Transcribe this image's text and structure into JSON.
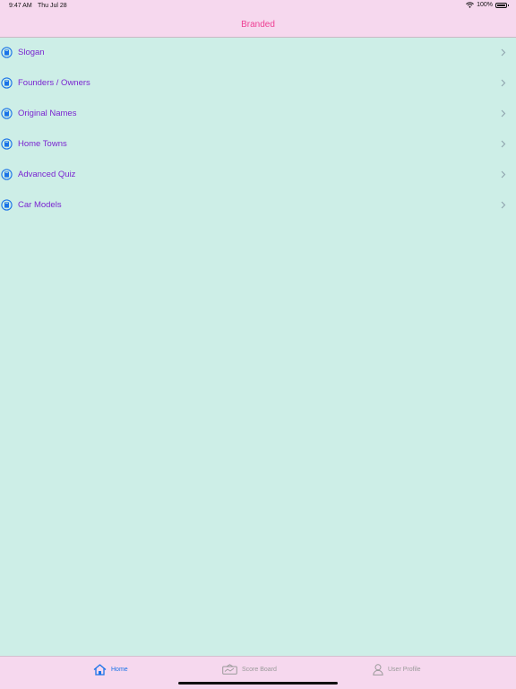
{
  "status_bar": {
    "time": "9:47 AM",
    "date": "Thu Jul 28",
    "battery": "100%",
    "battery_level": 1.0
  },
  "nav": {
    "title": "Branded"
  },
  "menu": {
    "items": [
      {
        "label": "Slogan",
        "icon": "book-icon"
      },
      {
        "label": "Founders / Owners",
        "icon": "book-icon"
      },
      {
        "label": "Original Names",
        "icon": "book-icon"
      },
      {
        "label": "Home Towns",
        "icon": "book-icon"
      },
      {
        "label": "Advanced Quiz",
        "icon": "book-icon"
      },
      {
        "label": "Car Models",
        "icon": "book-icon"
      }
    ]
  },
  "tabs": {
    "home": {
      "label": "Home",
      "icon": "house-icon",
      "active": true
    },
    "score_board": {
      "label": "Score Board",
      "icon": "scoreboard-icon",
      "active": false
    },
    "user_profile": {
      "label": "User Profile",
      "icon": "person-icon",
      "active": false
    }
  },
  "colors": {
    "background": "#cdeee7",
    "bar": "#f6d8ee",
    "title": "#ee3f93",
    "item_text": "#7a25d0",
    "icon_blue": "#1a73e8",
    "inactive": "#9a9a9a"
  }
}
